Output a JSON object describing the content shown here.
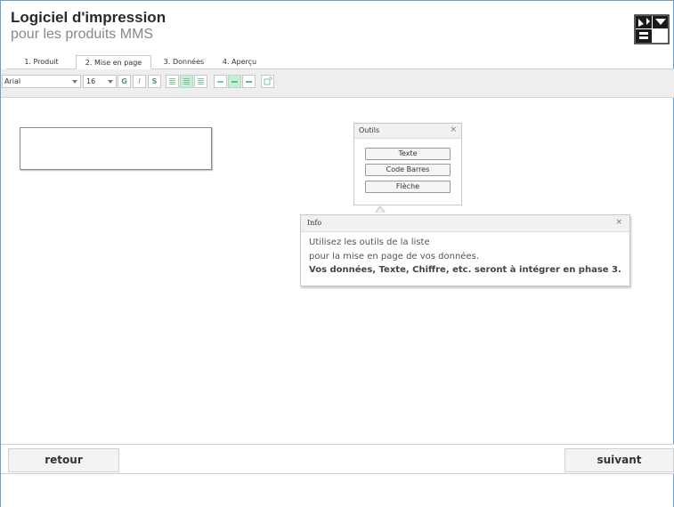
{
  "header": {
    "title": "Logiciel d'impression",
    "subtitle": "pour les produits MMS",
    "logo_icon": "mms-logo-icon"
  },
  "tabs": [
    {
      "label": "1. Produit",
      "active": false
    },
    {
      "label": "2. Mise en page",
      "active": true
    },
    {
      "label": "3. Données",
      "active": false
    },
    {
      "label": "4. Aperçu",
      "active": false
    }
  ],
  "toolbar": {
    "font_value": "Arial",
    "size_value": "16",
    "bold_label": "G",
    "italic_label": "I",
    "underline_label": "S",
    "align_icons": [
      "align-left-icon",
      "align-center-icon",
      "align-right-icon"
    ],
    "valign_icons": [
      "valign-top-icon",
      "valign-middle-icon",
      "valign-bottom-icon"
    ],
    "extra_icon": "rotate-icon",
    "accent_color": "#4a9a66"
  },
  "outils": {
    "title": "Outils",
    "close_label": "×",
    "buttons": [
      "Texte",
      "Code Barres",
      "Flèche"
    ]
  },
  "info": {
    "title": "Info",
    "close_label": "×",
    "line1": "Utilisez les outils de la liste",
    "line2": "pour la mise en page de vos données.",
    "line3": "Vos données, Texte, Chiffre, etc. seront à intégrer en phase 3."
  },
  "footer": {
    "back_label": "retour",
    "next_label": "suivant"
  }
}
